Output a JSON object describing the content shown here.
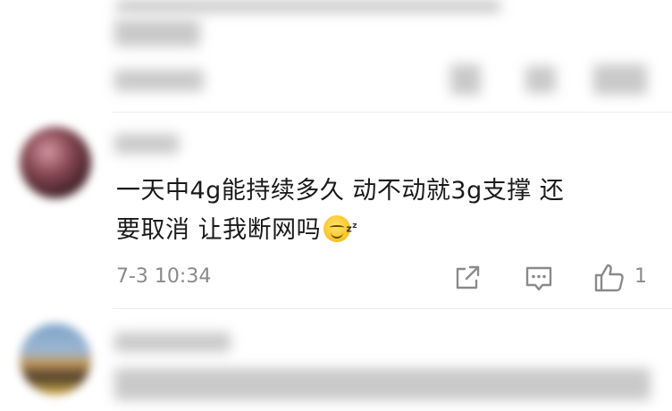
{
  "comment": {
    "text_line1": "一天中4g能持续多久 动不动就3g支撑 还",
    "text_line2": "要取消 让我断网吗",
    "emoji": "sleepy-grin-emoji",
    "timestamp": "7-3 10:34",
    "like_count": "1"
  },
  "icons": {
    "share": "share-icon",
    "reply": "comment-icon",
    "like": "thumbs-up-icon"
  },
  "colors": {
    "text": "#1a1a1a",
    "meta": "#8a8a8a",
    "divider": "#ececec"
  }
}
